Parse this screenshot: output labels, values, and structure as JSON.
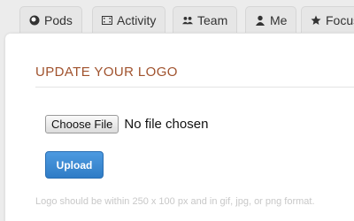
{
  "tabs": [
    {
      "label": "Pods",
      "icon": "pods-icon"
    },
    {
      "label": "Activity",
      "icon": "film-icon"
    },
    {
      "label": "Team",
      "icon": "team-icon"
    },
    {
      "label": "Me",
      "icon": "user-icon"
    },
    {
      "label": "Focus",
      "icon": "star-icon"
    }
  ],
  "section": {
    "title": "UPDATE YOUR LOGO"
  },
  "file_input": {
    "button_label": "Choose File",
    "status": "No file chosen"
  },
  "upload": {
    "label": "Upload"
  },
  "hint": "Logo should be within 250 x 100 px and in gif, jpg, or png format.",
  "colors": {
    "heading": "#a0522d",
    "button": "#3a87d0",
    "panel": "#ffffff",
    "background": "#ececec"
  }
}
